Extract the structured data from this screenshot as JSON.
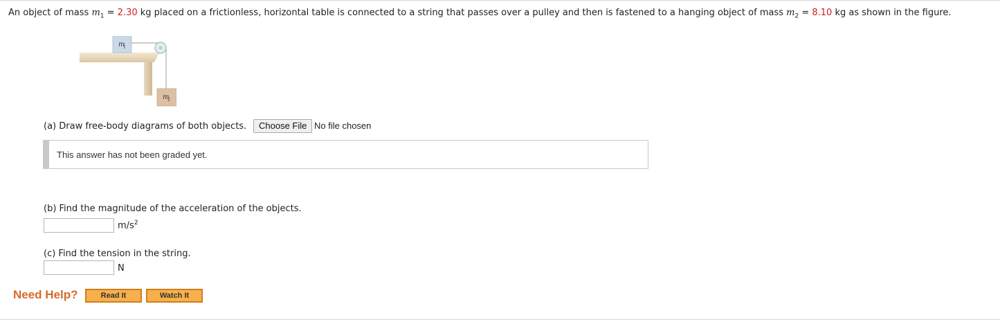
{
  "problem": {
    "t1": "An object of mass ",
    "m1_sym": "m",
    "m1_sub": "1",
    "t2": " = ",
    "m1_value": "2.30",
    "t3": " kg placed on a frictionless, horizontal table is connected to a string that passes over a pulley and then is fastened to a hanging object of mass ",
    "m2_sym": "m",
    "m2_sub": "2",
    "t4": " = ",
    "m2_value": "8.10",
    "t5": " kg as shown in the figure.",
    "value_color": "#cc1f1f"
  },
  "figure": {
    "m1_label": "m",
    "m1_sub": "1",
    "m2_label": "m",
    "m2_sub": "2"
  },
  "part_a": {
    "prompt": "(a) Draw free-body diagrams of both objects.",
    "file_button": "Choose File",
    "file_status": "No file chosen",
    "grade_status": "This answer has not been graded yet."
  },
  "part_b": {
    "prompt": "(b) Find the magnitude of the acceleration of the objects.",
    "answer": "",
    "unit_base": "m/s",
    "unit_exp": "2"
  },
  "part_c": {
    "prompt": "(c) Find the tension in the string.",
    "answer": "",
    "unit": "N"
  },
  "help": {
    "label": "Need Help?",
    "read_button": "Read It",
    "watch_button": "Watch It",
    "accent": "#d8692a"
  }
}
